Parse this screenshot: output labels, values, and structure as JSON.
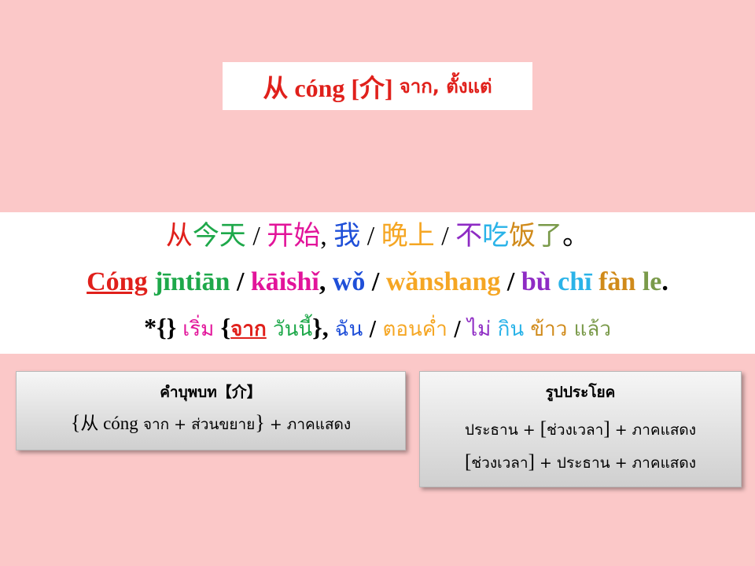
{
  "header": {
    "title_zh": "从 cóng [介]",
    "title_th": "จาก, ตั้งแต่"
  },
  "example": {
    "hanzi": [
      {
        "text": "从",
        "color": "#e0201b"
      },
      {
        "text": "今天",
        "color": "#1ea84a"
      },
      {
        "text": " / ",
        "color": "#000000"
      },
      {
        "text": "开始",
        "color": "#e2149a"
      },
      {
        "text": ", ",
        "color": "#000000"
      },
      {
        "text": "我",
        "color": "#1f4fd8"
      },
      {
        "text": " / ",
        "color": "#000000"
      },
      {
        "text": "晚上",
        "color": "#f5a623"
      },
      {
        "text": " / ",
        "color": "#000000"
      },
      {
        "text": "不",
        "color": "#8e2bc4"
      },
      {
        "text": "吃",
        "color": "#2ab3e8"
      },
      {
        "text": "饭",
        "color": "#d08a1a"
      },
      {
        "text": "了",
        "color": "#7a9a4a"
      },
      {
        "text": "。",
        "color": "#000000"
      }
    ],
    "pinyin": [
      {
        "text": "Cóng",
        "color": "#e0201b",
        "underline": true
      },
      {
        "text": " jīntiān",
        "color": "#1ea84a"
      },
      {
        "text": " / ",
        "color": "#000000"
      },
      {
        "text": "kāishǐ",
        "color": "#e2149a"
      },
      {
        "text": ", ",
        "color": "#000000"
      },
      {
        "text": "wǒ",
        "color": "#1f4fd8"
      },
      {
        "text": " / ",
        "color": "#000000"
      },
      {
        "text": "wǎnshang",
        "color": "#f5a623"
      },
      {
        "text": " / ",
        "color": "#000000"
      },
      {
        "text": "bù",
        "color": "#8e2bc4"
      },
      {
        "text": " chī",
        "color": "#2ab3e8"
      },
      {
        "text": " fàn",
        "color": "#d08a1a"
      },
      {
        "text": " le",
        "color": "#7a9a4a"
      },
      {
        "text": ".",
        "color": "#000000"
      }
    ],
    "thai": [
      {
        "text": "*{} ",
        "color": "#000000",
        "star": true
      },
      {
        "text": "เริ่ม ",
        "color": "#e2149a"
      },
      {
        "text": "{",
        "color": "#000000",
        "star": true
      },
      {
        "text": "จาก",
        "color": "#e0201b",
        "underline": true,
        "bold": true
      },
      {
        "text": " วันนี้",
        "color": "#1ea84a"
      },
      {
        "text": "}, ",
        "color": "#000000",
        "star": true
      },
      {
        "text": "ฉัน",
        "color": "#1f4fd8"
      },
      {
        "text": " / ",
        "color": "#000000"
      },
      {
        "text": "ตอนค่ำ",
        "color": "#f5a623"
      },
      {
        "text": " / ",
        "color": "#000000"
      },
      {
        "text": "ไม่",
        "color": "#8e2bc4"
      },
      {
        "text": " กิน",
        "color": "#2ab3e8"
      },
      {
        "text": " ข้าว",
        "color": "#d08a1a"
      },
      {
        "text": " แล้ว",
        "color": "#7a9a4a"
      }
    ]
  },
  "card_preposition": {
    "heading": "คำบุพบท【介】",
    "formula_open": "{",
    "formula_zh": "从 cóng",
    "formula_rest": " จาก + ส่วนขยาย",
    "formula_close": "}",
    "formula_tail": " + ภาคแสดง"
  },
  "card_pattern": {
    "heading": "รูปประโยค",
    "line1_a": "ประธาน + ",
    "line1_b": "[",
    "line1_c": "ช่วงเวลา",
    "line1_d": "]",
    "line1_e": " + ภาคแสดง",
    "line2_a": "[",
    "line2_b": "ช่วงเวลา",
    "line2_c": "]",
    "line2_d": " + ประธาน + ภาคแสดง"
  }
}
